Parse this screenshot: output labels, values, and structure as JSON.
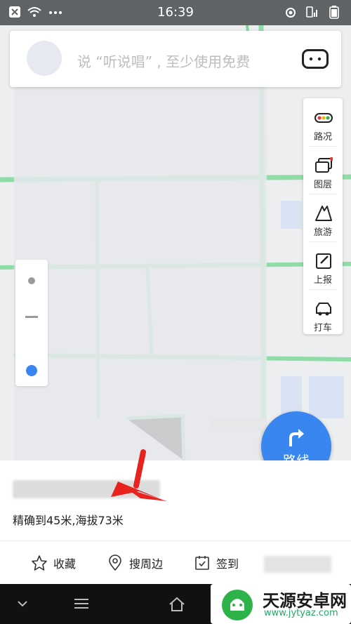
{
  "status_bar": {
    "time": "16:39"
  },
  "search": {
    "placeholder": "说 “听说唱” , 至少使用免费"
  },
  "tools": [
    {
      "label": "路况",
      "icon": "traffic-light-icon"
    },
    {
      "label": "图层",
      "icon": "layers-icon"
    },
    {
      "label": "旅游",
      "icon": "tourism-icon"
    },
    {
      "label": "上报",
      "icon": "report-icon"
    },
    {
      "label": "打车",
      "icon": "taxi-icon"
    }
  ],
  "route_button": {
    "label": "路线"
  },
  "place": {
    "accuracy_text": "精确到45米,海拔73米"
  },
  "actions": [
    {
      "label": "收藏",
      "icon": "star-icon"
    },
    {
      "label": "搜周边",
      "icon": "location-pin-icon"
    },
    {
      "label": "签到",
      "icon": "checkin-icon"
    }
  ],
  "watermark": {
    "name": "天源安卓网",
    "url": "www.jytyaz.com"
  },
  "colors": {
    "accent": "#3a86f1",
    "arrow": "#e8231f",
    "road": "#8fdca6"
  }
}
